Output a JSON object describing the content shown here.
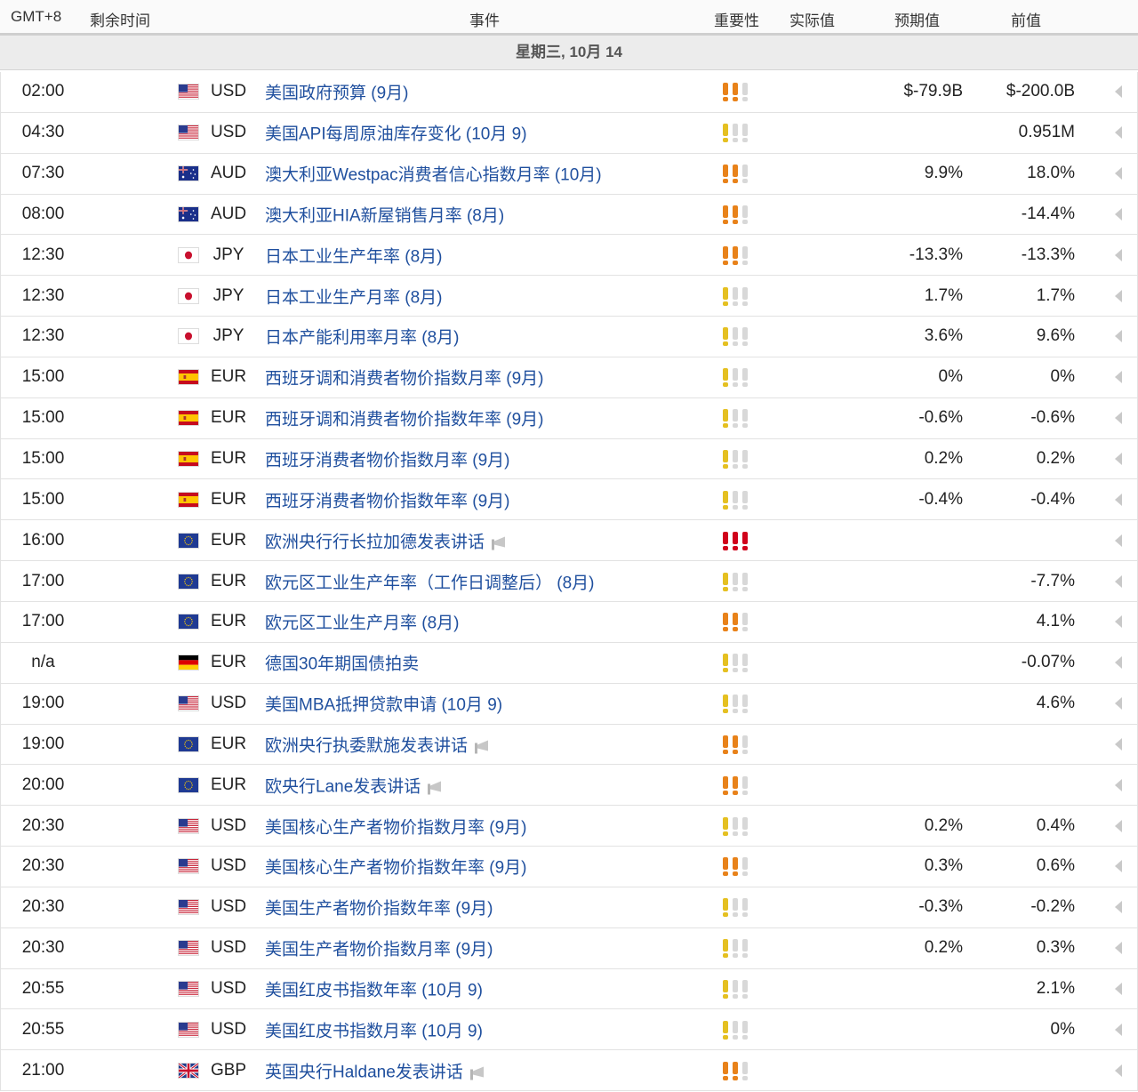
{
  "header": {
    "timezone": "GMT+8",
    "time_left": "剩余时间",
    "event": "事件",
    "importance": "重要性",
    "actual": "实际值",
    "forecast": "预期值",
    "previous": "前值"
  },
  "day_label": "星期三, 10月 14",
  "colors": {
    "event_link": "#1f4f9e",
    "importance_high": "#d0021b",
    "importance_medium": "#e8821a",
    "importance_low": "#e5c021",
    "importance_off": "#d8d8d8"
  },
  "events": [
    {
      "time": "02:00",
      "flag": "us",
      "currency": "USD",
      "event": "美国政府预算 (9月)",
      "importance": 2,
      "speech": false,
      "actual": "",
      "forecast": "$-79.9B",
      "previous": "$-200.0B"
    },
    {
      "time": "04:30",
      "flag": "us",
      "currency": "USD",
      "event": "美国API每周原油库存变化 (10月 9)",
      "importance": 1,
      "speech": false,
      "actual": "",
      "forecast": "",
      "previous": "0.951M"
    },
    {
      "time": "07:30",
      "flag": "au",
      "currency": "AUD",
      "event": "澳大利亚Westpac消费者信心指数月率 (10月)",
      "importance": 2,
      "speech": false,
      "actual": "",
      "forecast": "9.9%",
      "previous": "18.0%"
    },
    {
      "time": "08:00",
      "flag": "au",
      "currency": "AUD",
      "event": "澳大利亚HIA新屋销售月率 (8月)",
      "importance": 2,
      "speech": false,
      "actual": "",
      "forecast": "",
      "previous": "-14.4%"
    },
    {
      "time": "12:30",
      "flag": "jp",
      "currency": "JPY",
      "event": "日本工业生产年率 (8月)",
      "importance": 2,
      "speech": false,
      "actual": "",
      "forecast": "-13.3%",
      "previous": "-13.3%"
    },
    {
      "time": "12:30",
      "flag": "jp",
      "currency": "JPY",
      "event": "日本工业生产月率 (8月)",
      "importance": 1,
      "speech": false,
      "actual": "",
      "forecast": "1.7%",
      "previous": "1.7%"
    },
    {
      "time": "12:30",
      "flag": "jp",
      "currency": "JPY",
      "event": "日本产能利用率月率 (8月)",
      "importance": 1,
      "speech": false,
      "actual": "",
      "forecast": "3.6%",
      "previous": "9.6%"
    },
    {
      "time": "15:00",
      "flag": "es",
      "currency": "EUR",
      "event": "西班牙调和消费者物价指数月率 (9月)",
      "importance": 1,
      "speech": false,
      "actual": "",
      "forecast": "0%",
      "previous": "0%"
    },
    {
      "time": "15:00",
      "flag": "es",
      "currency": "EUR",
      "event": "西班牙调和消费者物价指数年率 (9月)",
      "importance": 1,
      "speech": false,
      "actual": "",
      "forecast": "-0.6%",
      "previous": "-0.6%"
    },
    {
      "time": "15:00",
      "flag": "es",
      "currency": "EUR",
      "event": "西班牙消费者物价指数月率 (9月)",
      "importance": 1,
      "speech": false,
      "actual": "",
      "forecast": "0.2%",
      "previous": "0.2%"
    },
    {
      "time": "15:00",
      "flag": "es",
      "currency": "EUR",
      "event": "西班牙消费者物价指数年率 (9月)",
      "importance": 1,
      "speech": false,
      "actual": "",
      "forecast": "-0.4%",
      "previous": "-0.4%"
    },
    {
      "time": "16:00",
      "flag": "eu",
      "currency": "EUR",
      "event": "欧洲央行行长拉加德发表讲话",
      "importance": 3,
      "speech": true,
      "actual": "",
      "forecast": "",
      "previous": ""
    },
    {
      "time": "17:00",
      "flag": "eu",
      "currency": "EUR",
      "event": "欧元区工业生产年率（工作日调整后） (8月)",
      "importance": 1,
      "speech": false,
      "actual": "",
      "forecast": "",
      "previous": "-7.7%"
    },
    {
      "time": "17:00",
      "flag": "eu",
      "currency": "EUR",
      "event": "欧元区工业生产月率 (8月)",
      "importance": 2,
      "speech": false,
      "actual": "",
      "forecast": "",
      "previous": "4.1%"
    },
    {
      "time": "n/a",
      "flag": "de",
      "currency": "EUR",
      "event": "德国30年期国债拍卖",
      "importance": 1,
      "speech": false,
      "actual": "",
      "forecast": "",
      "previous": "-0.07%"
    },
    {
      "time": "19:00",
      "flag": "us",
      "currency": "USD",
      "event": "美国MBA抵押贷款申请 (10月 9)",
      "importance": 1,
      "speech": false,
      "actual": "",
      "forecast": "",
      "previous": "4.6%"
    },
    {
      "time": "19:00",
      "flag": "eu",
      "currency": "EUR",
      "event": "欧洲央行执委默施发表讲话",
      "importance": 2,
      "speech": true,
      "actual": "",
      "forecast": "",
      "previous": ""
    },
    {
      "time": "20:00",
      "flag": "eu",
      "currency": "EUR",
      "event": "欧央行Lane发表讲话",
      "importance": 2,
      "speech": true,
      "actual": "",
      "forecast": "",
      "previous": ""
    },
    {
      "time": "20:30",
      "flag": "us",
      "currency": "USD",
      "event": "美国核心生产者物价指数月率 (9月)",
      "importance": 1,
      "speech": false,
      "actual": "",
      "forecast": "0.2%",
      "previous": "0.4%"
    },
    {
      "time": "20:30",
      "flag": "us",
      "currency": "USD",
      "event": "美国核心生产者物价指数年率 (9月)",
      "importance": 2,
      "speech": false,
      "actual": "",
      "forecast": "0.3%",
      "previous": "0.6%"
    },
    {
      "time": "20:30",
      "flag": "us",
      "currency": "USD",
      "event": "美国生产者物价指数年率 (9月)",
      "importance": 1,
      "speech": false,
      "actual": "",
      "forecast": "-0.3%",
      "previous": "-0.2%"
    },
    {
      "time": "20:30",
      "flag": "us",
      "currency": "USD",
      "event": "美国生产者物价指数月率 (9月)",
      "importance": 1,
      "speech": false,
      "actual": "",
      "forecast": "0.2%",
      "previous": "0.3%"
    },
    {
      "time": "20:55",
      "flag": "us",
      "currency": "USD",
      "event": "美国红皮书指数年率 (10月 9)",
      "importance": 1,
      "speech": false,
      "actual": "",
      "forecast": "",
      "previous": "2.1%"
    },
    {
      "time": "20:55",
      "flag": "us",
      "currency": "USD",
      "event": "美国红皮书指数月率 (10月 9)",
      "importance": 1,
      "speech": false,
      "actual": "",
      "forecast": "",
      "previous": "0%"
    },
    {
      "time": "21:00",
      "flag": "gb",
      "currency": "GBP",
      "event": "英国央行Haldane发表讲话",
      "importance": 2,
      "speech": true,
      "actual": "",
      "forecast": "",
      "previous": ""
    }
  ]
}
